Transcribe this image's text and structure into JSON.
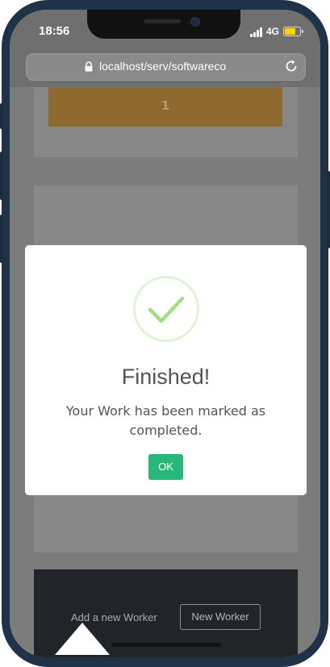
{
  "status_bar": {
    "time": "18:56",
    "network": "4G",
    "signal_icon": "signal-icon",
    "battery_icon": "battery-icon"
  },
  "browser": {
    "url": "localhost/serv/softwareco",
    "lock_icon": "lock-icon",
    "reload_icon": "reload-icon"
  },
  "background": {
    "card_value": "1",
    "footer": {
      "add_text": "Add a new Worker",
      "new_button": "New Worker"
    }
  },
  "modal": {
    "title": "Finished!",
    "message": "Your Work has been marked as completed.",
    "ok_label": "OK",
    "icon": "checkmark-icon",
    "ok_color": "#28b97a",
    "check_color": "#a5dc86"
  }
}
